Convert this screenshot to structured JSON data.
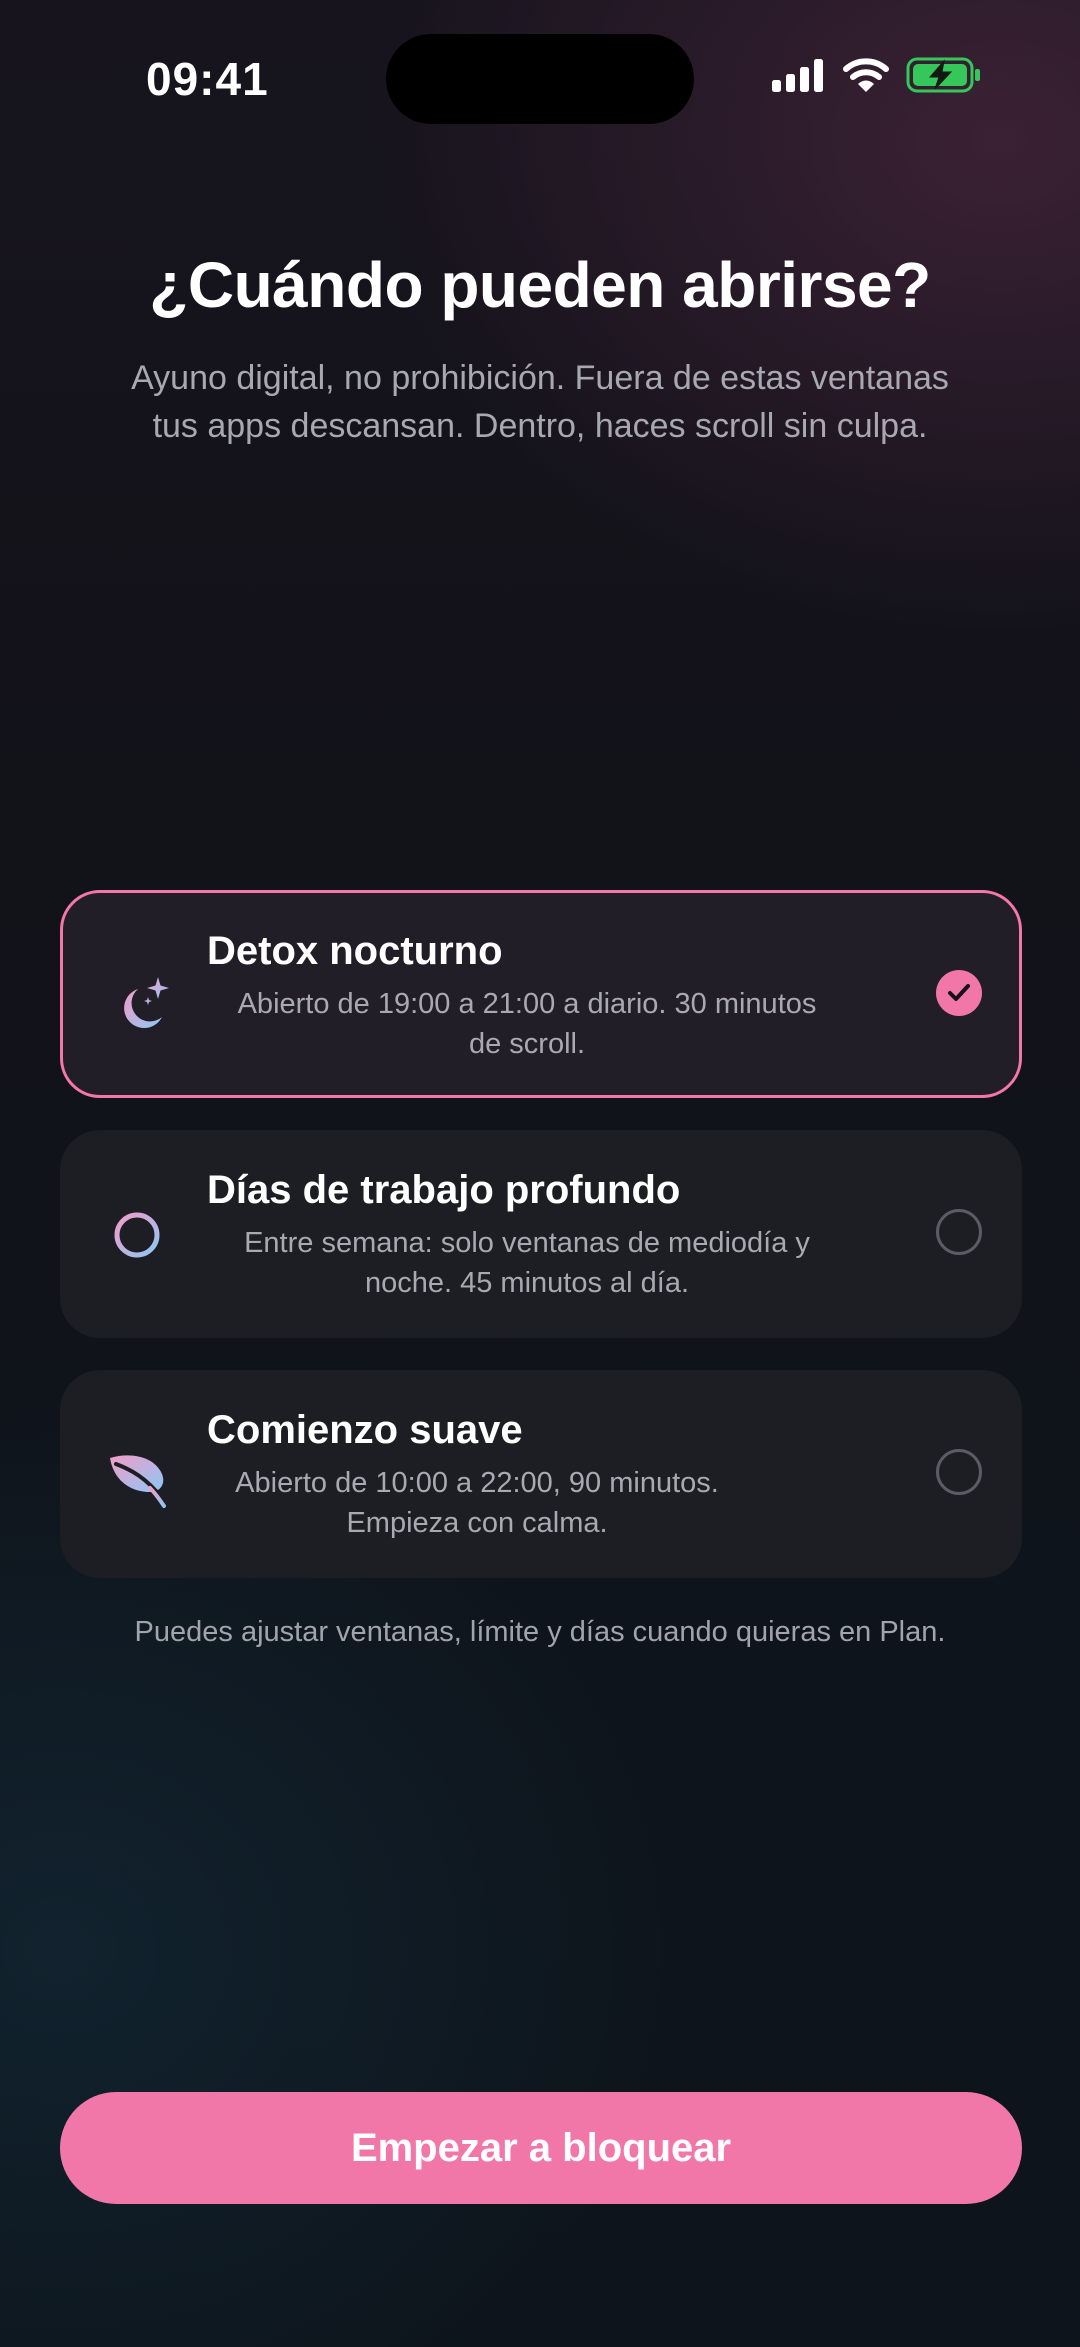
{
  "status": {
    "time": "09:41"
  },
  "header": {
    "title": "¿Cuándo pueden abrirse?",
    "subtitle_line1": "Ayuno digital, no prohibición. Fuera de estas ventanas",
    "subtitle_line2": "tus apps descansan. Dentro, haces scroll sin culpa."
  },
  "options": [
    {
      "title": "Detox nocturno",
      "desc_line1": "Abierto de 19:00 a 21:00 a diario. 30 minutos",
      "desc_line2": "de scroll.",
      "icon": "moon-stars-icon",
      "selected": true
    },
    {
      "title": "Días de trabajo profundo",
      "desc_line1": "Entre semana: solo ventanas de mediodía y",
      "desc_line2": "noche. 45 minutos al día.",
      "icon": "crosshair-icon",
      "selected": false
    },
    {
      "title": "Comienzo suave",
      "desc_line1": "Abierto de 10:00 a 22:00, 90 minutos.",
      "desc_line2": "Empieza con calma.",
      "icon": "leaf-icon",
      "selected": false
    }
  ],
  "footnote": "Puedes ajustar ventanas, límite y días cuando quieras en Plan.",
  "cta": {
    "label": "Empezar a bloquear"
  },
  "colors": {
    "accent": "#f277a9",
    "battery": "#35c759",
    "card_bg": "#1d1e24"
  }
}
